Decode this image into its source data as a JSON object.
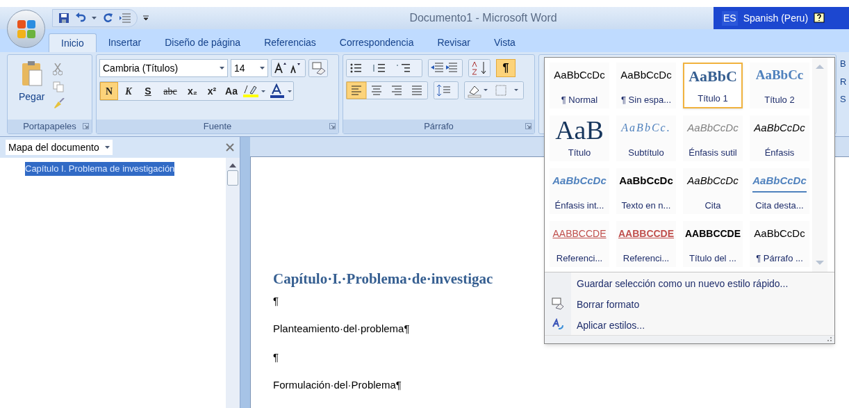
{
  "window": {
    "title": "Documento1 - Microsoft Word"
  },
  "language_bar": {
    "code": "ES",
    "language": "Spanish (Peru)"
  },
  "tabs": [
    {
      "label": "Inicio",
      "selected": true
    },
    {
      "label": "Insertar",
      "selected": false
    },
    {
      "label": "Diseño de página",
      "selected": false
    },
    {
      "label": "Referencias",
      "selected": false
    },
    {
      "label": "Correspondencia",
      "selected": false
    },
    {
      "label": "Revisar",
      "selected": false
    },
    {
      "label": "Vista",
      "selected": false
    }
  ],
  "clipboard": {
    "label": "Portapapeles",
    "paste": "Pegar"
  },
  "font_group": {
    "label": "Fuente",
    "font": "Cambria (Títulos)",
    "size": "14",
    "format_buttons": [
      {
        "text": "N",
        "on": true
      },
      {
        "text": "K",
        "on": false
      },
      {
        "text": "S",
        "on": false
      },
      {
        "text": "abc",
        "on": false
      },
      {
        "text": "x₂",
        "on": false
      },
      {
        "text": "x²",
        "on": false
      },
      {
        "text": "Aa",
        "on": false
      }
    ]
  },
  "paragraph_group": {
    "label": "Párrafo",
    "marks_symbol": "¶",
    "show_marks": true,
    "align_left": true
  },
  "styles_edge": [
    "B",
    "R",
    "S"
  ],
  "document_map": {
    "title": "Mapa del documento",
    "items": [
      {
        "label": "Capítulo I. Problema de investigación",
        "selected": true
      }
    ]
  },
  "document": {
    "paragraphs": [
      {
        "kind": "heading",
        "text": "Capítulo·I.·Problema·de·investigac"
      },
      {
        "kind": "mark",
        "text": "¶"
      },
      {
        "kind": "body",
        "text": "Planteamiento·del·problema¶"
      },
      {
        "kind": "mark",
        "text": "¶"
      },
      {
        "kind": "body",
        "text": "Formulación·del·Problema¶"
      }
    ]
  },
  "styles_gallery": {
    "styles": [
      {
        "sample": "AaBbCcDc",
        "label": "¶ Normal",
        "kind": "normal",
        "selected": false
      },
      {
        "sample": "AaBbCcDc",
        "label": "¶ Sin espa...",
        "kind": "normal",
        "selected": false
      },
      {
        "sample": "AaBbC",
        "label": "Título 1",
        "kind": "heading1",
        "selected": true
      },
      {
        "sample": "AaBbCc",
        "label": "Título 2",
        "kind": "heading2",
        "selected": false
      },
      {
        "sample": "AaB",
        "label": "Título",
        "kind": "title",
        "selected": false
      },
      {
        "sample": "AaBbCc.",
        "label": "Subtítulo",
        "kind": "subtitle",
        "selected": false
      },
      {
        "sample": "AaBbCcDc",
        "label": "Énfasis sutil",
        "kind": "subtle",
        "selected": false
      },
      {
        "sample": "AaBbCcDc",
        "label": "Énfasis",
        "kind": "emphasis",
        "selected": false
      },
      {
        "sample": "AaBbCcDc",
        "label": "Énfasis int...",
        "kind": "intense",
        "selected": false
      },
      {
        "sample": "AaBbCcDc",
        "label": "Texto en n...",
        "kind": "strong",
        "selected": false
      },
      {
        "sample": "AaBbCcDc",
        "label": "Cita",
        "kind": "quote",
        "selected": false
      },
      {
        "sample": "AaBbCcDc",
        "label": "Cita desta...",
        "kind": "intense_quote",
        "selected": false
      },
      {
        "sample": "AABBCCDE",
        "label": "Referenci...",
        "kind": "subtle_ref",
        "selected": false
      },
      {
        "sample": "AABBCCDE",
        "label": "Referenci...",
        "kind": "intense_ref",
        "selected": false
      },
      {
        "sample": "AABBCCDE",
        "label": "Título del ...",
        "kind": "book_title",
        "selected": false
      },
      {
        "sample": "AaBbCcDc",
        "label": "¶ Párrafo ...",
        "kind": "normal",
        "selected": false
      }
    ],
    "menu": [
      {
        "label": "Guardar selección como un nuevo estilo rápido...",
        "kind": "save"
      },
      {
        "label": "Borrar formato",
        "kind": "clear"
      },
      {
        "label": "Aplicar estilos...",
        "kind": "apply"
      }
    ]
  }
}
